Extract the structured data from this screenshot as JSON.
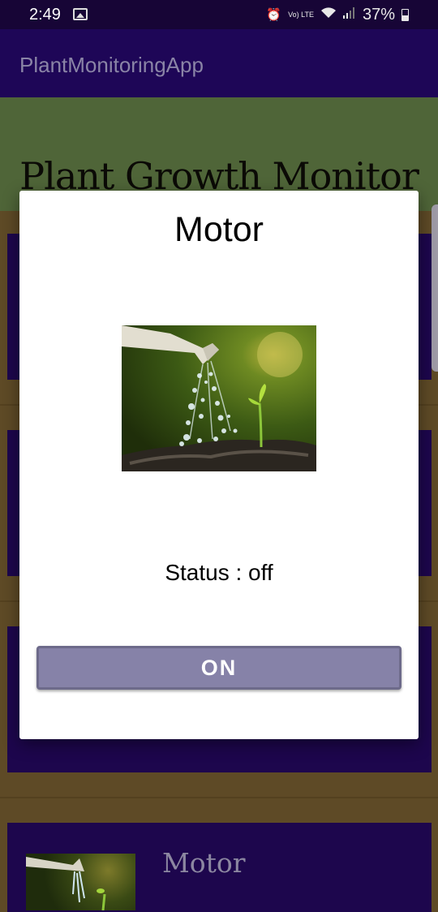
{
  "status_bar": {
    "time": "2:49",
    "lte_label": "Vo) LTE",
    "battery": "37%"
  },
  "app_bar": {
    "title": "PlantMonitoringApp"
  },
  "header": {
    "title": "Plant Growth Monitor"
  },
  "background_list": {
    "visible_card_label": "Motor"
  },
  "dialog": {
    "title": "Motor",
    "status_text": "Status : off",
    "button_label": "ON"
  },
  "colors": {
    "status_bar": "#170536",
    "app_bar": "#1e0657",
    "header": "#4f6538",
    "card": "#1d064d",
    "page_bg": "#5e4a26",
    "button": "#8682a8"
  }
}
